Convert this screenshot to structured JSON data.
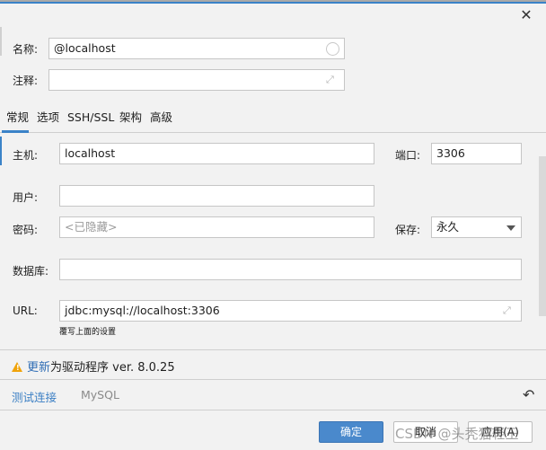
{
  "dialog": {
    "close_label": "✕",
    "name_label": "名称:",
    "name_value": "@localhost",
    "comment_label": "注释:",
    "comment_value": ""
  },
  "tabs": [
    {
      "label": "常规",
      "active": true
    },
    {
      "label": "选项",
      "active": false
    },
    {
      "label": "SSH/SSL",
      "active": false
    },
    {
      "label": "架构",
      "active": false
    },
    {
      "label": "高级",
      "active": false
    }
  ],
  "general": {
    "host_label": "主机:",
    "host_value": "localhost",
    "port_label": "端口:",
    "port_value": "3306",
    "user_label": "用户:",
    "user_value": "",
    "password_label": "密码:",
    "password_placeholder": "<已隐藏>",
    "save_label": "保存:",
    "save_value": "永久",
    "database_label": "数据库:",
    "database_value": "",
    "url_label": "URL:",
    "url_value": "jdbc:mysql://localhost:3306",
    "url_hint": "覆写上面的设置"
  },
  "warning": {
    "icon": "warning-icon",
    "link_text": "更新",
    "text": "为驱动程序 ver. 8.0.25"
  },
  "footer": {
    "test_connection": "测试连接",
    "driver": "MySQL",
    "undo_icon": "undo-icon"
  },
  "buttons": {
    "ok": "确定",
    "cancel": "取消",
    "apply": "应用(A)"
  },
  "watermark": "CSDN @头秃猫轻王"
}
